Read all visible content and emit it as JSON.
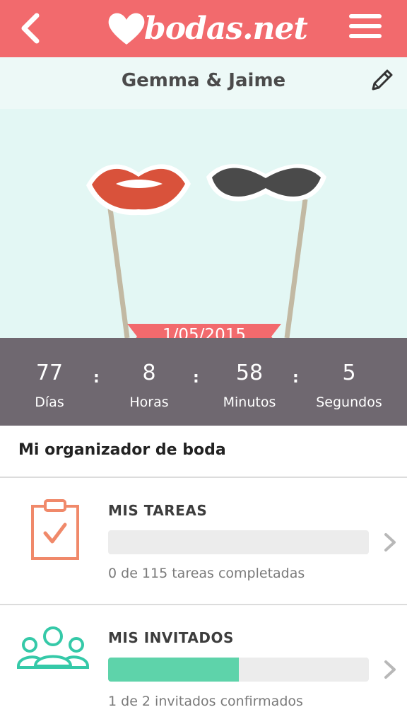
{
  "header": {
    "logo_text": "bodas.net",
    "back_icon": "back-chevron-icon",
    "menu_icon": "hamburger-icon",
    "bg_color": "#f26a6d"
  },
  "couple": {
    "names": "Gemma & Jaime",
    "edit_icon": "pencil-icon"
  },
  "wedding_date": "1/05/2015",
  "countdown": [
    {
      "value": "77",
      "label": "Días"
    },
    {
      "value": "8",
      "label": "Horas"
    },
    {
      "value": "58",
      "label": "Minutos"
    },
    {
      "value": "5",
      "label": "Segundos"
    }
  ],
  "organizer": {
    "title": "Mi organizador de boda",
    "items": [
      {
        "title": "MIS TAREAS",
        "status": "0 de 115 tareas completadas",
        "done": 0,
        "total": 115,
        "icon": "clipboard-check-icon",
        "icon_color": "#f0896a"
      },
      {
        "title": "MIS INVITADOS",
        "status": "1 de 2 invitados confirmados",
        "done": 1,
        "total": 2,
        "icon": "guests-icon",
        "icon_color": "#35c9a8",
        "bar_color": "#5ed3aa"
      }
    ]
  }
}
